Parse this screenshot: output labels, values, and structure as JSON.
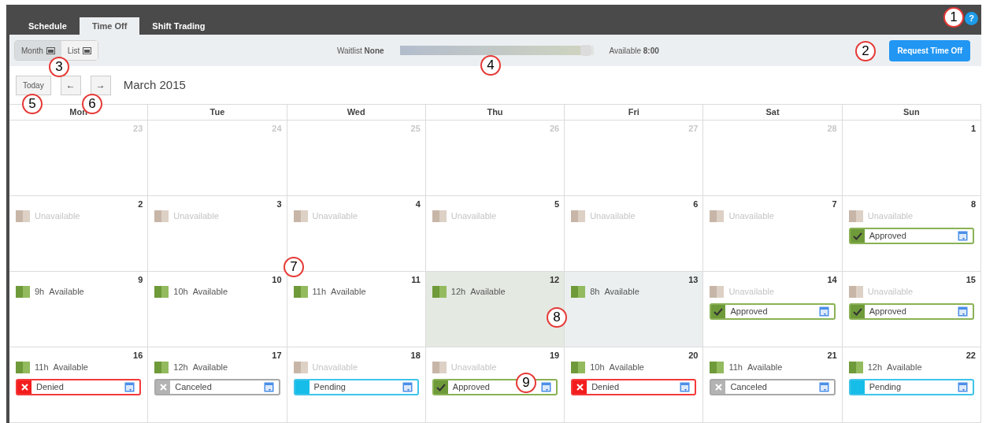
{
  "tabs": [
    {
      "label": "Schedule",
      "selected": false
    },
    {
      "label": "Time Off",
      "selected": true
    },
    {
      "label": "Shift Trading",
      "selected": false
    }
  ],
  "help": {
    "label": "?"
  },
  "view_toggle": [
    {
      "label": "Month",
      "selected": true
    },
    {
      "label": "List",
      "selected": false
    }
  ],
  "waitlist": {
    "label": "Waitlist",
    "value": "None"
  },
  "hours_slider": {
    "level": 0.97
  },
  "available": {
    "label": "Available",
    "value": "8:00"
  },
  "request_button": "Request Time Off",
  "today_button": "Today",
  "nav": [
    "←",
    "→"
  ],
  "month_title": "March 2015",
  "weekdays": [
    "Mon",
    "Tue",
    "Wed",
    "Thu",
    "Fri",
    "Sat",
    "Sun"
  ],
  "weeks": [
    [
      {
        "day": "23",
        "other_month": true
      },
      {
        "day": "24",
        "other_month": true
      },
      {
        "day": "25",
        "other_month": true
      },
      {
        "day": "26",
        "other_month": true
      },
      {
        "day": "27",
        "other_month": true
      },
      {
        "day": "28",
        "other_month": true
      },
      {
        "day": "1",
        "other_month": false
      }
    ],
    [
      {
        "day": "2",
        "other_month": false,
        "availability": {
          "kind": "unavailable",
          "text": "Unavailable"
        }
      },
      {
        "day": "3",
        "other_month": false,
        "availability": {
          "kind": "unavailable",
          "text": "Unavailable"
        }
      },
      {
        "day": "4",
        "other_month": false,
        "availability": {
          "kind": "unavailable",
          "text": "Unavailable"
        }
      },
      {
        "day": "5",
        "other_month": false,
        "availability": {
          "kind": "unavailable",
          "text": "Unavailable"
        }
      },
      {
        "day": "6",
        "other_month": false,
        "availability": {
          "kind": "unavailable",
          "text": "Unavailable"
        }
      },
      {
        "day": "7",
        "other_month": false,
        "availability": {
          "kind": "unavailable",
          "text": "Unavailable"
        }
      },
      {
        "day": "8",
        "other_month": false,
        "availability": {
          "kind": "unavailable",
          "text": "Unavailable"
        },
        "request": {
          "kind": "approved",
          "text": "Approved"
        }
      }
    ],
    [
      {
        "day": "9",
        "other_month": false,
        "availability": {
          "kind": "available",
          "hours": "9h",
          "text": "Available"
        }
      },
      {
        "day": "10",
        "other_month": false,
        "availability": {
          "kind": "available",
          "hours": "10h",
          "text": "Available"
        }
      },
      {
        "day": "11",
        "other_month": false,
        "availability": {
          "kind": "available",
          "hours": "11h",
          "text": "Available"
        }
      },
      {
        "day": "12",
        "other_month": false,
        "color": "#e4e9e2",
        "availability": {
          "kind": "available",
          "hours": "12h",
          "text": "Available"
        }
      },
      {
        "day": "13",
        "other_month": false,
        "color": "#ebeff0",
        "availability": {
          "kind": "available",
          "hours": "8h",
          "text": "Available"
        }
      },
      {
        "day": "14",
        "other_month": false,
        "availability": {
          "kind": "unavailable",
          "text": "Unavailable"
        },
        "request": {
          "kind": "approved",
          "text": "Approved"
        }
      },
      {
        "day": "15",
        "other_month": false,
        "availability": {
          "kind": "unavailable",
          "text": "Unavailable"
        },
        "request": {
          "kind": "approved",
          "text": "Approved"
        }
      }
    ],
    [
      {
        "day": "16",
        "other_month": false,
        "availability": {
          "kind": "available",
          "hours": "11h",
          "text": "Available"
        },
        "request": {
          "kind": "denied",
          "text": "Denied"
        }
      },
      {
        "day": "17",
        "other_month": false,
        "availability": {
          "kind": "available",
          "hours": "12h",
          "text": "Available"
        },
        "request": {
          "kind": "canceled",
          "text": "Canceled"
        }
      },
      {
        "day": "18",
        "other_month": false,
        "availability": {
          "kind": "unavailable",
          "text": "Unavailable"
        },
        "request": {
          "kind": "pending",
          "text": "Pending"
        }
      },
      {
        "day": "19",
        "other_month": false,
        "availability": {
          "kind": "unavailable",
          "text": "Unavailable"
        },
        "request": {
          "kind": "approved",
          "text": "Approved"
        }
      },
      {
        "day": "20",
        "other_month": false,
        "availability": {
          "kind": "available",
          "hours": "10h",
          "text": "Available"
        },
        "request": {
          "kind": "denied",
          "text": "Denied"
        }
      },
      {
        "day": "21",
        "other_month": false,
        "availability": {
          "kind": "available",
          "hours": "11h",
          "text": "Available"
        },
        "request": {
          "kind": "canceled",
          "text": "Canceled"
        }
      },
      {
        "day": "22",
        "other_month": false,
        "availability": {
          "kind": "available",
          "hours": "12h",
          "text": "Available"
        },
        "request": {
          "kind": "pending",
          "text": "Pending"
        }
      }
    ]
  ],
  "callouts": [
    "1",
    "2",
    "3",
    "4",
    "5",
    "6",
    "7",
    "8",
    "9"
  ]
}
